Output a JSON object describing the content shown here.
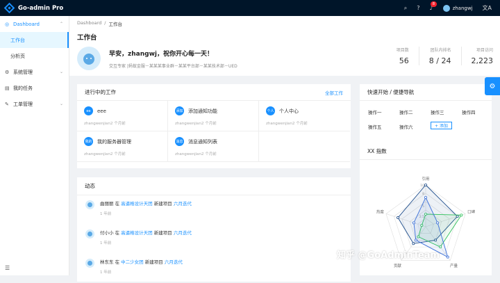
{
  "app": {
    "title": "Go-admin Pro"
  },
  "topbar": {
    "notify_count": "8",
    "username": "zhangwj",
    "lang_icon": "文A"
  },
  "sidebar": {
    "items": [
      {
        "label": "Dashboard",
        "icon": "◎"
      },
      {
        "label": "工作台"
      },
      {
        "label": "分析页"
      },
      {
        "label": "系统管理",
        "icon": "⚙"
      },
      {
        "label": "我的任务",
        "icon": "▤"
      },
      {
        "label": "工单管理",
        "icon": "✎"
      }
    ],
    "collapse_icon": "☰"
  },
  "breadcrumb": {
    "root": "Dashboard",
    "sep": "/",
    "current": "工作台"
  },
  "page_title": "工作台",
  "welcome": {
    "greeting": "早安，zhangwj，祝你开心每一天！",
    "subtitle": "交互专家 |蚂蚁金服－某某某事业群－某某平台部－某某技术部－UED"
  },
  "stats": [
    {
      "label": "项目数",
      "value": "56"
    },
    {
      "label": "团队内排名",
      "value": "8 / 24"
    },
    {
      "label": "项目访问",
      "value": "2,223"
    }
  ],
  "projects": {
    "title": "进行中的工作",
    "extra": "全部工作",
    "items": [
      {
        "icon": "ee",
        "name": "eee",
        "meta": "zhangwenjian2 个月前"
      },
      {
        "icon": "添加",
        "name": "添加通知功能",
        "meta": "zhangwenjian2 个月前"
      },
      {
        "icon": "个人",
        "name": "个人中心",
        "meta": "zhangwenjian2 个月前"
      },
      {
        "icon": "我的",
        "name": "我的服务器管理",
        "meta": "zhangwenjian2 个月前"
      },
      {
        "icon": "消息",
        "name": "消息通知列表",
        "meta": "zhangwenjian2 个月前"
      }
    ]
  },
  "activity": {
    "title": "动态",
    "items": [
      {
        "user": "曲丽丽",
        "mid": "在",
        "group": "高逼格设计天团",
        "action": "新建项目",
        "project": "六月迭代",
        "time": "1 年前"
      },
      {
        "user": "付小小",
        "mid": "在",
        "group": "高逼格设计天团",
        "action": "新建项目",
        "project": "六月迭代",
        "time": "1 年前"
      },
      {
        "user": "林东东",
        "mid": "在",
        "group": "中二少女团",
        "action": "新建项目",
        "project": "六月迭代",
        "time": "1 年前"
      }
    ]
  },
  "quick": {
    "title": "快速开始 / 便捷导航",
    "links": [
      "操作一",
      "操作二",
      "操作三",
      "操作四",
      "操作五",
      "操作六"
    ],
    "add_label": "+ 添加"
  },
  "radar": {
    "title": "XX 指数"
  },
  "chart_data": {
    "type": "radar",
    "indicators": [
      "引用",
      "口碑",
      "产量",
      "贡献",
      "热度"
    ],
    "max": 10,
    "ticks": [
      "10",
      "8",
      "5",
      "2.5"
    ],
    "series": [
      {
        "values": [
          10,
          8,
          4,
          5,
          7
        ],
        "color": "#1f4e8c"
      },
      {
        "values": [
          3,
          9,
          6,
          3,
          1
        ],
        "color": "#2fc25b"
      },
      {
        "values": [
          7,
          3,
          9,
          4,
          3
        ],
        "color": "#3a6fd8"
      }
    ]
  },
  "watermark": "知乎 @GoAdminTeam"
}
